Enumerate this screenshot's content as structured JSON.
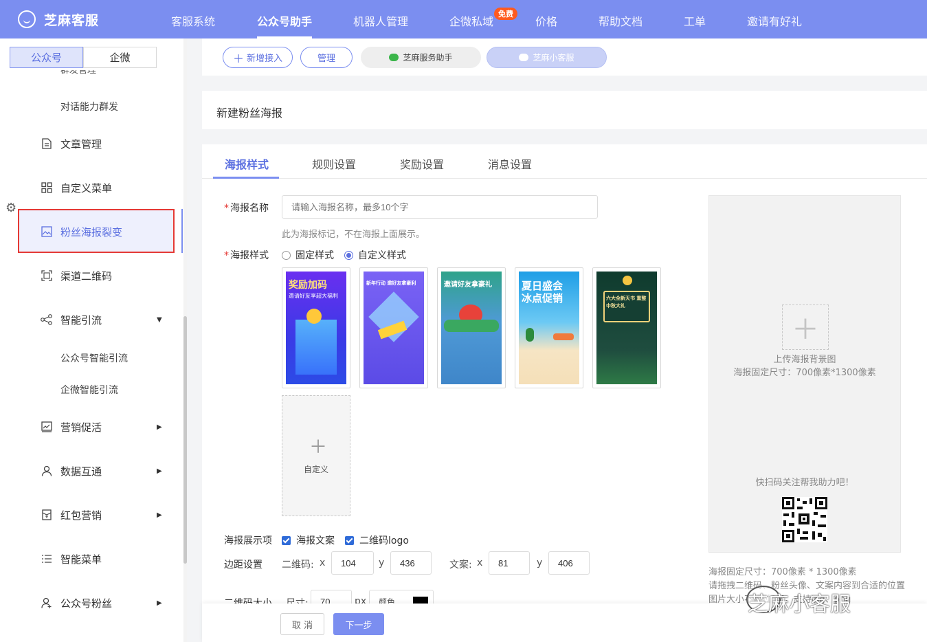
{
  "brand": {
    "name": "芝麻客服"
  },
  "topnav": {
    "items": [
      "客服系统",
      "公众号助手",
      "机器人管理",
      "企微私域",
      "价格",
      "帮助文档",
      "工单",
      "邀请有好礼"
    ],
    "active": "公众号助手",
    "badge": "免费"
  },
  "sidebar": {
    "toggle": [
      "公众号",
      "企微"
    ],
    "cut_item": "群发管理",
    "items": [
      {
        "label": "对话能力群发",
        "type": "sub"
      },
      {
        "label": "文章管理",
        "icon": "document-icon"
      },
      {
        "label": "自定义菜单",
        "icon": "grid-icon"
      },
      {
        "label": "粉丝海报裂变",
        "icon": "image-icon",
        "active": true
      },
      {
        "label": "渠道二维码",
        "icon": "scan-icon"
      },
      {
        "label": "智能引流",
        "icon": "share-icon",
        "arrow": "down"
      },
      {
        "label": "公众号智能引流",
        "type": "sub"
      },
      {
        "label": "企微智能引流",
        "type": "sub"
      },
      {
        "label": "营销促活",
        "icon": "chart-icon",
        "arrow": "right"
      },
      {
        "label": "数据互通",
        "icon": "user-icon",
        "arrow": "right"
      },
      {
        "label": "红包营销",
        "icon": "redpacket-icon",
        "arrow": "right"
      },
      {
        "label": "智能菜单",
        "icon": "list-icon"
      },
      {
        "label": "公众号粉丝",
        "icon": "fans-icon",
        "arrow": "right"
      }
    ]
  },
  "subnav": {
    "add": "新增接入",
    "manage": "管理",
    "accounts": [
      "芝麻服务助手",
      "芝麻小客服"
    ]
  },
  "page": {
    "title": "新建粉丝海报"
  },
  "tabs": [
    "海报样式",
    "规则设置",
    "奖励设置",
    "消息设置"
  ],
  "form": {
    "name_label": "海报名称",
    "name_placeholder": "请输入海报名称，最多10个字",
    "name_hint": "此为海报标记，不在海报上面展示。",
    "style_label": "海报样式",
    "style_options": [
      "固定样式",
      "自定义样式"
    ],
    "style_selected": "自定义样式",
    "templates": [
      {
        "title": "奖励加码",
        "subtitle": "邀请好友享超大福利",
        "color": "#4a3ee0"
      },
      {
        "title": "新年行动 邀好友拿豪利",
        "subtitle": "",
        "color": "#6f5cf0"
      },
      {
        "title": "邀请好友拿豪礼",
        "subtitle": "",
        "color": "#4d8fd1"
      },
      {
        "title": "夏日盛会 冰点促销",
        "subtitle": "",
        "color": "#2aa7e8"
      },
      {
        "title": "六大全新天书 重整中秋大礼",
        "subtitle": "",
        "color": "#1f4d3f"
      }
    ],
    "custom_label": "自定义",
    "display_label": "海报展示项",
    "display_items": [
      "海报文案",
      "二维码logo"
    ],
    "margin_label": "边距设置",
    "qr_label": "二维码:",
    "text_label": "文案:",
    "x": "x",
    "y": "y",
    "qr_x": "104",
    "qr_y": "436",
    "text_x": "81",
    "text_y": "406",
    "qr_size_label": "二维码大小",
    "size_label": "尺寸:",
    "size_value": "70",
    "px": "px",
    "color_label": "颜色"
  },
  "preview": {
    "upload": "上传海报背景图",
    "size_tip": "海报固定尺寸：700像素*1300像素",
    "scan_tip": "快扫码关注帮我助力吧！",
    "note1": "海报固定尺寸：700像素 * 1300像素",
    "note2": "请拖拽二维码、粉丝头像、文案内容到合适的位置",
    "note3": "图片大小不超过1M，支持jpg、png"
  },
  "footer": {
    "cancel": "取 消",
    "next": "下一步"
  },
  "watermark": "芝麻小客服"
}
